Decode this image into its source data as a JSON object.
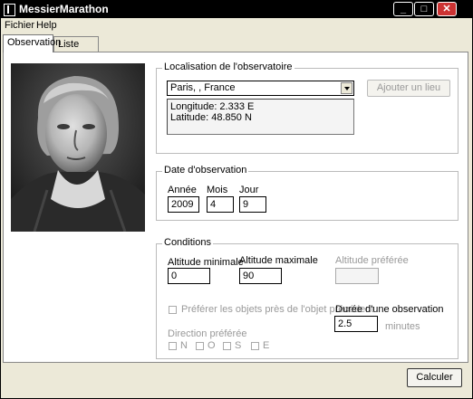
{
  "window": {
    "title": "MessierMarathon"
  },
  "menu": {
    "fichier": "Fichier",
    "help": "Help"
  },
  "tabs": {
    "observation": "Observation",
    "liste": "Liste triée"
  },
  "localisation": {
    "group_title": "Localisation de l'observatoire",
    "location_value": "Paris, , France",
    "add_button": "Ajouter un lieu",
    "longitude": "Longitude: 2.333 E",
    "latitude": "Latitude: 48.850 N"
  },
  "date": {
    "group_title": "Date d'observation",
    "year_label": "Année",
    "year_value": "2009",
    "month_label": "Mois",
    "month_value": "4",
    "day_label": "Jour",
    "day_value": "9"
  },
  "conditions": {
    "group_title": "Conditions",
    "alt_min_label": "Altitude minimale",
    "alt_min_value": "0",
    "alt_max_label": "Altitude maximale",
    "alt_max_value": "90",
    "alt_pref_label": "Altitude préférée",
    "alt_pref_value": "",
    "prefer_near_label": "Préférer les objets près de l'objet précédent",
    "duration_label": "Durée d'une observation",
    "duration_value": "2.5",
    "duration_unit": "minutes",
    "direction_label": "Direction préférée",
    "dir_n": "N",
    "dir_o": "O",
    "dir_s": "S",
    "dir_e": "E"
  },
  "footer": {
    "calculate_button": "Calculer"
  }
}
